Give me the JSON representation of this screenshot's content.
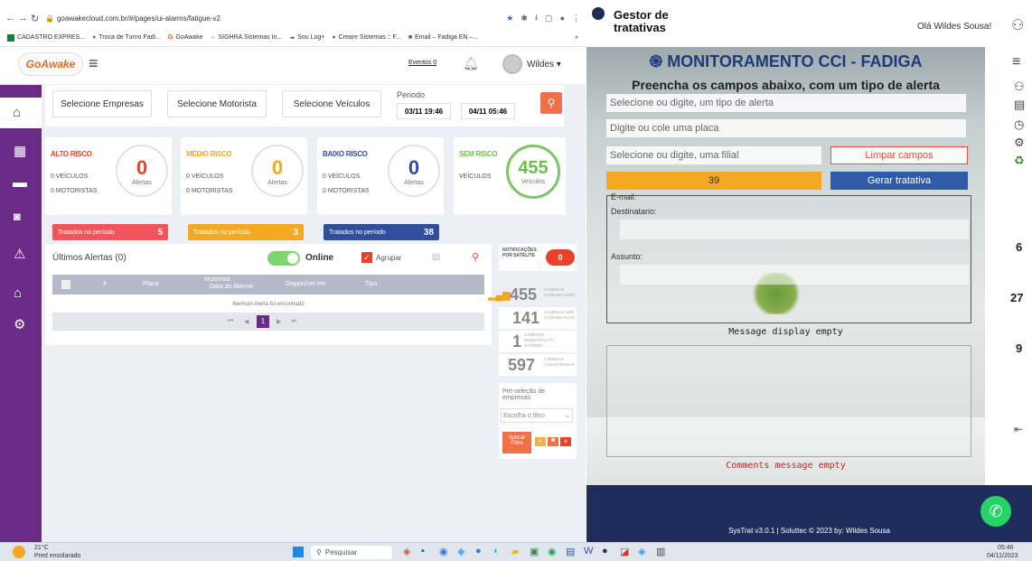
{
  "browser": {
    "url": "goawakecloud.com.br/#/pages/ui-alarms/fatigue-v2",
    "bookmarks": [
      "CADASTRO EXPRES...",
      "Troca de Turno Fadi...",
      "GoAwake",
      "SIGHRA Sistemas In...",
      "Sou Log+",
      "Creare Sistemas :: F...",
      "Email – Fadiga EN –..."
    ],
    "more": "»"
  },
  "goawake": {
    "logo": "GoAwake",
    "eventos": "Eventos 0",
    "user": "Wildes ▾",
    "filters": {
      "empresa": "Selecione Empresas",
      "motorista": "Selecione Motorista",
      "veiculo": "Selecione Veículos",
      "periodo_label": "Periodo",
      "start": "03/11 19:46",
      "end": "04/11 05:46"
    },
    "risks": [
      {
        "title": "ALTO RISCO",
        "color": "#e8412c",
        "veiculos": "0 VEÍCULOS",
        "motoristas": "0 MOTORISTAS",
        "count": "0",
        "unit": "Alertas"
      },
      {
        "title": "MÉDIO RISCO",
        "color": "#f3a720",
        "veiculos": "0 VEÍCULOS",
        "motoristas": "0 MOTORISTAS",
        "count": "0",
        "unit": "Alertas"
      },
      {
        "title": "BAIXO RISCO",
        "color": "#2f4e9b",
        "veiculos": "0 VEÍCULOS",
        "motoristas": "0 MOTORISTAS",
        "count": "0",
        "unit": "Alertas"
      },
      {
        "title": "SEM RISCO",
        "color": "#6cc04a",
        "veiculos": "VEÍCULOS",
        "count": "455",
        "unit": "Veículos"
      }
    ],
    "treated": [
      {
        "label": "Tratados no período",
        "value": "5",
        "color": "#f2545b"
      },
      {
        "label": "Tratados no período",
        "value": "3",
        "color": "#f4a923"
      },
      {
        "label": "Tratados no período",
        "value": "38",
        "color": "#2f4e9b"
      }
    ],
    "alerts": {
      "title": "Últimos Alertas (0)",
      "online": "Online",
      "agrupar": "Agrupar",
      "cols": [
        "#",
        "Placa",
        "Motorista",
        "Data do Alarme",
        "Disponível em",
        "Tipo"
      ],
      "empty": "Nenhum Alerta foi encontrado",
      "page": "1"
    },
    "notif": {
      "label": "NOTIFICAÇÕES POR SATÉLITE",
      "count": "0"
    },
    "stats": [
      {
        "n": "455",
        "l": "CÂMERAS COMUNICANDO"
      },
      {
        "n": "141",
        "l": "CÂMERAS SEM COMUNICAÇÃO"
      },
      {
        "n": "1",
        "l": "CÂMERAS MANUTENÇÃO / STANDBY"
      },
      {
        "n": "597",
        "l": "CÂMERAS CADASTRADAS"
      }
    ],
    "preselect": {
      "label": "Pré-seleção de empresas:",
      "placeholder": "Escolha o filtro",
      "apply": "Aplicar Filtro"
    }
  },
  "app": {
    "title": "Gestor de tratativas",
    "greeting": "Olá Wildes Sousa!",
    "heading": "MONITORAMENTO CCI - FADIGA",
    "subheading": "Preencha os campos abaixo, com um tipo de alerta",
    "ph_alert": "Selecione ou digite, um tipo de alerta",
    "ph_plate": "Digite ou cole uma placa",
    "ph_filial": "Selecione ou digite, uma filial",
    "clear": "Limpar campos",
    "count": "39",
    "generate": "Gerar tratativa",
    "email": "E-mail:",
    "dest": "Destinatario:",
    "subject": "Assunto:",
    "msg_empty": "Message display empty",
    "comments_empty": "Comments message empty",
    "side_nums": [
      "6",
      "27",
      "9"
    ],
    "footer": "SysTrat v3.0.1 |  Soluttec  © 2023  by: Wildes Sousa"
  },
  "taskbar": {
    "temp": "21°C",
    "weather": "Pred ensolarado",
    "search": "Pesquisar",
    "time": "05:46",
    "date": "04/11/2023"
  }
}
